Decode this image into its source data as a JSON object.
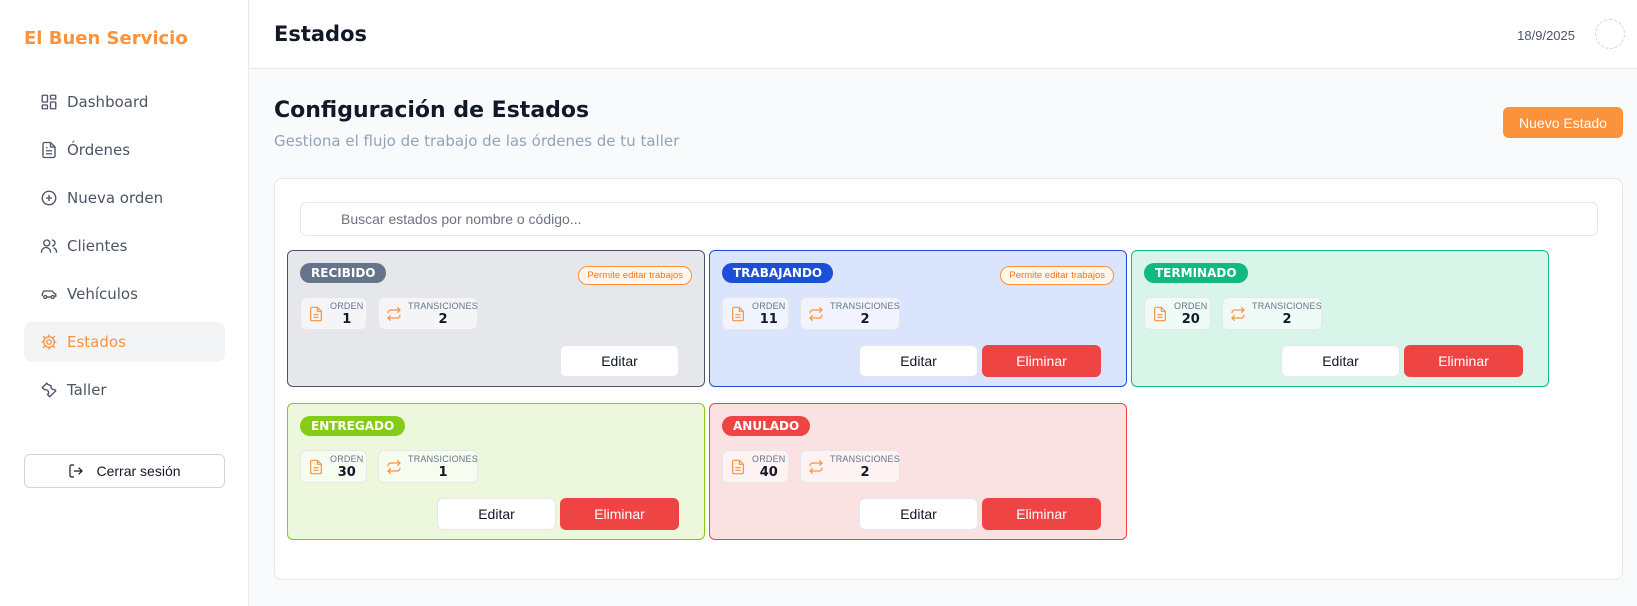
{
  "app": {
    "brand": "El Buen Servicio"
  },
  "sidebar": {
    "items": [
      {
        "label": "Dashboard",
        "icon": "dashboard-icon"
      },
      {
        "label": "Órdenes",
        "icon": "document-icon"
      },
      {
        "label": "Nueva orden",
        "icon": "plus-circle-icon"
      },
      {
        "label": "Clientes",
        "icon": "users-icon"
      },
      {
        "label": "Vehículos",
        "icon": "car-icon"
      },
      {
        "label": "Estados",
        "icon": "gear-icon",
        "active": true
      },
      {
        "label": "Taller",
        "icon": "wrench-icon"
      }
    ],
    "logout_label": "Cerrar sesión"
  },
  "header": {
    "title": "Estados",
    "date": "18/9/2025"
  },
  "page": {
    "title": "Configuración de Estados",
    "subtitle": "Gestiona el flujo de trabajo de las órdenes de tu taller",
    "new_button": "Nuevo Estado"
  },
  "search": {
    "placeholder": "Buscar estados por nombre o código..."
  },
  "labels": {
    "orden": "ORDEN",
    "transiciones": "TRANSICIONES",
    "permite": "Permite editar trabajos",
    "editar": "Editar",
    "eliminar": "Eliminar"
  },
  "colors": {
    "accent": "#fb923c",
    "danger": "#ef4444"
  },
  "states": [
    {
      "name": "RECIBIDO",
      "orden": "1",
      "transiciones": "2",
      "permite_editar": true,
      "eliminable": false,
      "badge_color": "#64748b",
      "bg": "#e5e7eb",
      "border": "#475569"
    },
    {
      "name": "TRABAJANDO",
      "orden": "11",
      "transiciones": "2",
      "permite_editar": true,
      "eliminable": true,
      "badge_color": "#1d4ed8",
      "bg": "#dbe4fd",
      "border": "#1d4ed8"
    },
    {
      "name": "TERMINADO",
      "orden": "20",
      "transiciones": "2",
      "permite_editar": false,
      "eliminable": true,
      "badge_color": "#10b981",
      "bg": "#d9f5ea",
      "border": "#10b981"
    },
    {
      "name": "ENTREGADO",
      "orden": "30",
      "transiciones": "1",
      "permite_editar": false,
      "eliminable": true,
      "badge_color": "#84cc16",
      "bg": "#ecf7dc",
      "border": "#84cc16"
    },
    {
      "name": "ANULADO",
      "orden": "40",
      "transiciones": "2",
      "permite_editar": false,
      "eliminable": true,
      "badge_color": "#ef4444",
      "bg": "#fbe2e2",
      "border": "#ef4444"
    }
  ]
}
